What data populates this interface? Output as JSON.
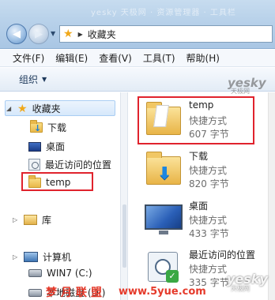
{
  "titlebar": {
    "ghost_text": "yesky 天极网 · 资源管理器 · 工具栏"
  },
  "address": {
    "breadcrumb": "收藏夹"
  },
  "menu": [
    "文件(F)",
    "编辑(E)",
    "查看(V)",
    "工具(T)",
    "帮助(H)"
  ],
  "toolbar": {
    "organize_label": "组织"
  },
  "nav": {
    "favorites": "收藏夹",
    "downloads": "下载",
    "desktop": "桌面",
    "recent": "最近访问的位置",
    "temp": "temp",
    "libraries": "库",
    "computer": "计算机",
    "drive_c": "WIN7 (C:)",
    "drive_d": "本地磁盘 (D:)"
  },
  "items": [
    {
      "name": "temp",
      "type": "快捷方式",
      "size": "607 字节"
    },
    {
      "name": "下载",
      "type": "快捷方式",
      "size": "820 字节"
    },
    {
      "name": "桌面",
      "type": "快捷方式",
      "size": "433 字节"
    },
    {
      "name": "最近访问的位置",
      "type": "快捷方式",
      "size": "335 字节"
    }
  ],
  "watermarks": {
    "yesky": "yesky",
    "yesky_sub": "天极网",
    "cn": "梦月联盟",
    "url": "www.5yue.com"
  },
  "colors": {
    "highlight_box": "#e0232d",
    "watermark_red": "#e53a2b"
  }
}
